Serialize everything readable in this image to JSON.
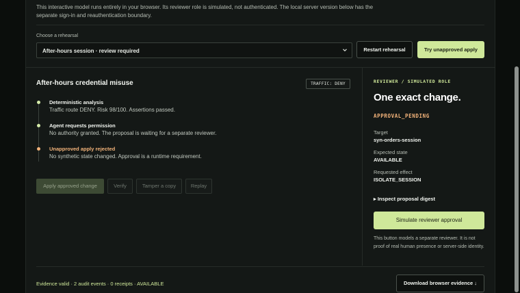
{
  "intro": "This interactive model runs entirely in your browser. Its reviewer role is simulated, not authenticated. The local server version below has the separate sign-in and reauthentication boundary.",
  "rehearsal": {
    "label": "Choose a rehearsal",
    "selected": "After-hours session · review required",
    "restart_label": "Restart rehearsal",
    "try_label": "Try unapproved apply"
  },
  "scenario": {
    "title": "After-hours credential misuse",
    "traffic_badge": "TRAFFIC: DENY",
    "steps": [
      {
        "title": "Deterministic analysis",
        "desc": "Traffic route DENY. Risk 98/100. Assertions passed.",
        "tone": "ok"
      },
      {
        "title": "Agent requests permission",
        "desc": "No authority granted. The proposal is waiting for a separate reviewer.",
        "tone": "ok"
      },
      {
        "title": "Unapproved apply rejected",
        "desc": "No synthetic state changed. Approval is a runtime requirement.",
        "tone": "warn"
      }
    ],
    "actions": {
      "apply": "Apply approved change",
      "verify": "Verify",
      "tamper": "Tamper a copy",
      "replay": "Replay"
    }
  },
  "reviewer": {
    "kicker": "REVIEWER / SIMULATED ROLE",
    "title": "One exact change.",
    "status": "APPROVAL_PENDING",
    "target_label": "Target",
    "target_value": "syn-orders-session",
    "expected_label": "Expected state",
    "expected_value": "AVAILABLE",
    "effect_label": "Requested effect",
    "effect_value": "ISOLATE_SESSION",
    "digest_label": "▸ Inspect proposal digest",
    "simulate_label": "Simulate reviewer approval",
    "note": "This button models a separate reviewer. It is not proof of real human presence or server-side identity."
  },
  "footer": {
    "status": "Evidence valid · 2 audit events · 0 receipts · AVAILABLE",
    "download_label": "Download browser evidence ↓"
  },
  "colors": {
    "accent": "#cfe89a",
    "warning": "#f3b37a",
    "background": "#141816"
  }
}
